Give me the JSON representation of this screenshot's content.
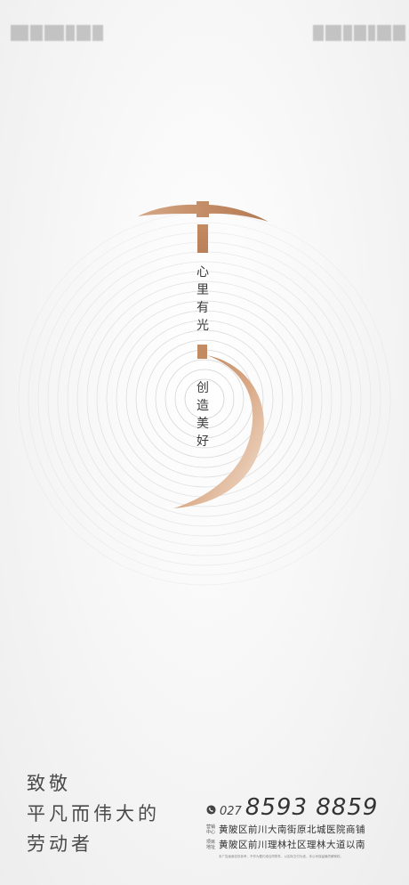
{
  "colors": {
    "accent_gold": "#c79066",
    "accent_gold_light": "#e8cdb4",
    "ring": "#c9c9c9",
    "text": "#3a3a3a"
  },
  "icons": {
    "pickaxe": "pickaxe-icon",
    "phone": "phone-icon"
  },
  "poster": {
    "vertical_text_top": [
      "心",
      "里",
      "有",
      "光"
    ],
    "vertical_text_bottom": [
      "创",
      "造",
      "美",
      "好"
    ],
    "tagline": [
      "致敬",
      "平凡而伟大的",
      "劳动者"
    ]
  },
  "contact": {
    "phone_prefix": "027",
    "phone_number": "8593  8859",
    "address_lines": [
      {
        "tag": "营销中心",
        "text": "黄陂区前川大南街原北城医院商铺"
      },
      {
        "tag": "项目地址",
        "text": "黄陂区前川理林社区理林大道以南"
      }
    ],
    "disclaimer": "本广告画面仅供参考，不作为要约或合同附件，以实际交付为准，本公司保留最终解释权。"
  }
}
